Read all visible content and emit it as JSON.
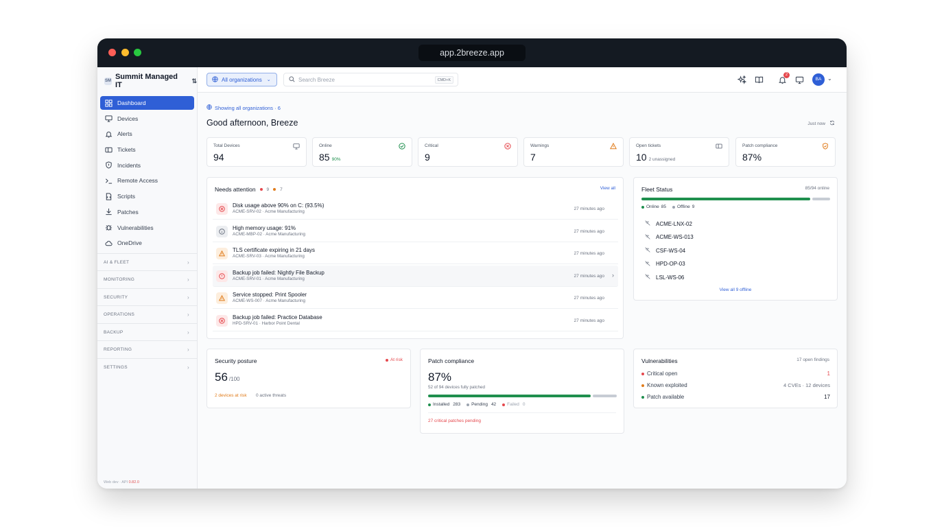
{
  "browser": {
    "url": "app.2breeze.app"
  },
  "sidebar": {
    "org_name": "Summit Managed IT",
    "org_logo": "SM",
    "items": [
      {
        "label": "Dashboard",
        "icon": "dashboard-icon"
      },
      {
        "label": "Devices",
        "icon": "monitor-icon"
      },
      {
        "label": "Alerts",
        "icon": "bell-icon"
      },
      {
        "label": "Tickets",
        "icon": "ticket-icon"
      },
      {
        "label": "Incidents",
        "icon": "shield-icon"
      },
      {
        "label": "Remote Access",
        "icon": "terminal-icon"
      },
      {
        "label": "Scripts",
        "icon": "script-icon"
      },
      {
        "label": "Patches",
        "icon": "download-icon"
      },
      {
        "label": "Vulnerabilities",
        "icon": "bug-icon"
      },
      {
        "label": "OneDrive",
        "icon": "cloud-icon"
      }
    ],
    "sections": [
      "AI & FLEET",
      "MONITORING",
      "SECURITY",
      "OPERATIONS",
      "BACKUP",
      "REPORTING",
      "SETTINGS"
    ],
    "version_prefix": "Web dev · API",
    "version": "0.82.0"
  },
  "topbar": {
    "org_select": "All organizations",
    "search_placeholder": "Search Breeze",
    "search_shortcut": "CMD+K",
    "notification_count": "2",
    "avatar": "BA"
  },
  "main": {
    "showing": "Showing all organizations · 6",
    "greeting": "Good afternoon, Breeze",
    "refreshed": "Just now"
  },
  "stats": [
    {
      "label": "Total Devices",
      "value": "94",
      "sub": "",
      "icon": "monitor-icon"
    },
    {
      "label": "Online",
      "value": "85",
      "sub": "90%",
      "icon": "check-circle-icon"
    },
    {
      "label": "Critical",
      "value": "9",
      "sub": "",
      "icon": "x-circle-icon"
    },
    {
      "label": "Warnings",
      "value": "7",
      "sub": "",
      "icon": "warning-icon"
    },
    {
      "label": "Open tickets",
      "value": "10",
      "sub": "2 unassigned",
      "icon": "ticket-icon"
    },
    {
      "label": "Patch compliance",
      "value": "87%",
      "sub": "",
      "icon": "shield-check-icon"
    }
  ],
  "attention": {
    "title": "Needs attention",
    "critical_count": "9",
    "warning_count": "7",
    "view_all": "View all",
    "items": [
      {
        "title": "Disk usage above 90% on C: (93.5%)",
        "sub": "ACME-SRV-02 · Acme Manufacturing",
        "time": "27 minutes ago",
        "kind": "critical"
      },
      {
        "title": "High memory usage: 91%",
        "sub": "ACME-MBP-02 · Acme Manufacturing",
        "time": "27 minutes ago",
        "kind": "info"
      },
      {
        "title": "TLS certificate expiring in 21 days",
        "sub": "ACME-SRV-03 · Acme Manufacturing",
        "time": "27 minutes ago",
        "kind": "warning"
      },
      {
        "title": "Backup job failed: Nightly File Backup",
        "sub": "ACME-SRV-01 · Acme Manufacturing",
        "time": "27 minutes ago",
        "kind": "error"
      },
      {
        "title": "Service stopped: Print Spooler",
        "sub": "ACME-WS-007 · Acme Manufacturing",
        "time": "27 minutes ago",
        "kind": "warning"
      },
      {
        "title": "Backup job failed: Practice Database",
        "sub": "HPD-SRV-01 · Harbor Point Dental",
        "time": "27 minutes ago",
        "kind": "critical"
      }
    ]
  },
  "fleet": {
    "title": "Fleet Status",
    "summary": "85/94 online",
    "online_fraction": 0.904,
    "online_label": "Online",
    "online_count": "85",
    "offline_label": "Offline",
    "offline_count": "9",
    "offline_devices": [
      "ACME-LNX-02",
      "ACME-WS-013",
      "CSF-WS-04",
      "HPD-OP-03",
      "LSL-WS-06"
    ],
    "view_all": "View all 9 offline"
  },
  "security": {
    "title": "Security posture",
    "status": "At risk",
    "score": "56",
    "score_max": "/100",
    "devices_at_risk": "2 devices at risk",
    "active_threats": "0 active threats"
  },
  "patch": {
    "title": "Patch compliance",
    "value": "87%",
    "sub": "52 of 94 devices fully patched",
    "installed_fraction": 0.87,
    "installed_label": "Installed",
    "installed": "283",
    "pending_label": "Pending",
    "pending": "42",
    "failed_label": "Failed",
    "failed": "0",
    "critical_pending": "27 critical patches pending"
  },
  "vulns": {
    "title": "Vulnerabilities",
    "summary": "17 open findings",
    "rows": [
      {
        "label": "Critical open",
        "value": "1"
      },
      {
        "label": "Known exploited",
        "value": "4 CVEs · 12 devices"
      },
      {
        "label": "Patch available",
        "value": "17"
      }
    ]
  },
  "colors": {
    "accent": "#2f5fd6",
    "green": "#1f8f4e",
    "red": "#e5484d",
    "orange": "#e07b1a",
    "grey": "#c7ccd4"
  }
}
